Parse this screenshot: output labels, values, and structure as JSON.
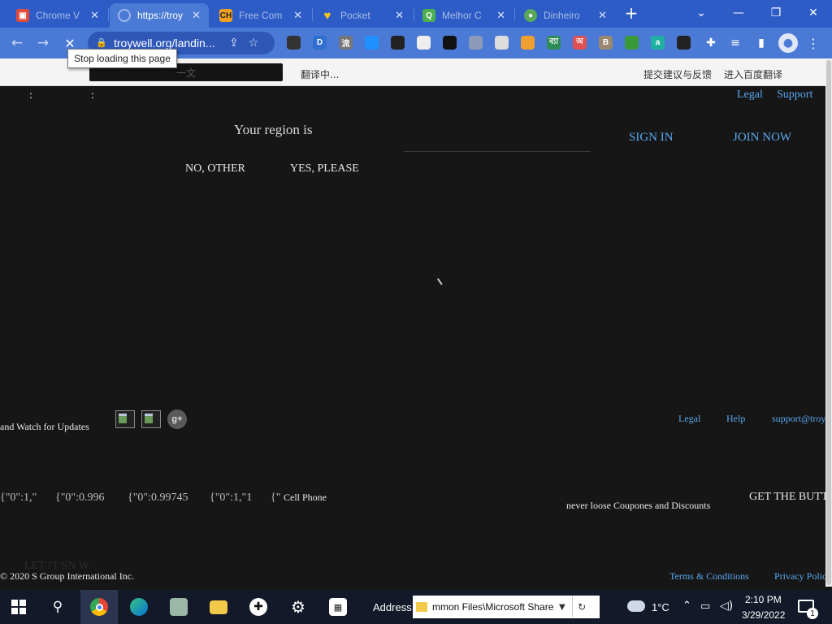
{
  "browser": {
    "tabs": [
      {
        "title": "Chrome V",
        "favicon": "ms-store-icon",
        "color": "#e14c3a"
      },
      {
        "title": "https://troy",
        "favicon": "loading-icon",
        "color": "#7f9fe0",
        "active": true
      },
      {
        "title": "Free Com",
        "favicon": "ch-icon",
        "color": "#f0a020"
      },
      {
        "title": "Pocket",
        "favicon": "heart-icon",
        "color": "#f5c518"
      },
      {
        "title": "Melhor C",
        "favicon": "q-icon",
        "color": "#4caf50"
      },
      {
        "title": "Dinheiro",
        "favicon": "piggy-icon",
        "color": "#5aa85a"
      }
    ],
    "new_tab": "+",
    "tab_search": "⌄",
    "window_controls": {
      "minimize": "—",
      "restore": "❐",
      "close": "✕"
    },
    "address": "troywell.org/landin...",
    "tooltip": "Stop loading this page",
    "extensions": [
      {
        "label": "",
        "color": "#333333"
      },
      {
        "label": "D",
        "color": "#2f6fd0"
      },
      {
        "label": "流",
        "color": "#777777"
      },
      {
        "label": "",
        "color": "#1e90ff"
      },
      {
        "label": "",
        "color": "#222222"
      },
      {
        "label": "",
        "color": "#eeeeee"
      },
      {
        "label": "",
        "color": "#111111"
      },
      {
        "label": "",
        "color": "#8a9ab8"
      },
      {
        "label": "",
        "color": "#dddddd"
      },
      {
        "label": "",
        "color": "#f0a030"
      },
      {
        "label": "ব্যা",
        "color": "#2e8b57"
      },
      {
        "label": "অ",
        "color": "#e05050"
      },
      {
        "label": "B",
        "color": "#9a8870"
      },
      {
        "label": "",
        "color": "#3a9a3a"
      },
      {
        "label": "a",
        "color": "#20b0a0"
      },
      {
        "label": "",
        "color": "#222222"
      }
    ]
  },
  "translate_bar": {
    "lang_box": "一文",
    "status": "翻译中...",
    "feedback": "提交建议与反馈",
    "open": "进入百度翻译"
  },
  "page": {
    "top_colon_left": ":",
    "top_colon_right": ":",
    "legal": "Legal",
    "support": "Support",
    "region_title": "Your region is",
    "no_other": "NO, OTHER",
    "yes_please": "YES, PLEASE",
    "sign_in": "SIGN IN",
    "join_now": "JOIN NOW",
    "watch_updates": "and Watch for Updates",
    "gplus": "g+",
    "footer_legal": "Legal",
    "footer_help": "Help",
    "footer_support": "support@troy",
    "json_1": "{\"0\":1,\"",
    "json_2": "{\"0\":0.996",
    "json_3": "{\"0\":0.99745",
    "json_4": "{\"0\":1,\"1",
    "json_5": "{\"",
    "cell_phone": "Cell Phone",
    "coupons": "never loose Coupones and Discounts",
    "get_button": "GET THE BUTT",
    "let_it_snow": "LET IT SN W",
    "copyright": "© 2020 S Group International Inc.",
    "terms": "Terms & Conditions",
    "privacy": "Privacy Polic"
  },
  "taskbar": {
    "address_label": "Address",
    "address_value": "mmon Files\\Microsoft Shared",
    "temperature": "1°C",
    "time": "2:10 PM",
    "date": "3/29/2022",
    "notification_count": "1"
  }
}
